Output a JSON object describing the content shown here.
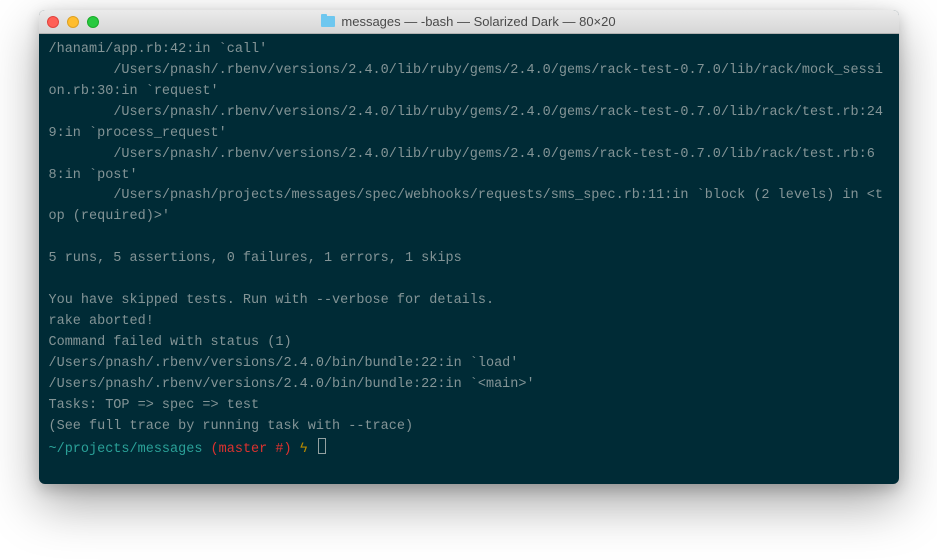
{
  "window": {
    "title": "messages — -bash — Solarized Dark — 80×20"
  },
  "terminal": {
    "lines": {
      "l0": "/hanami/app.rb:42:in `call'",
      "l1": "        /Users/pnash/.rbenv/versions/2.4.0/lib/ruby/gems/2.4.0/gems/rack-test-0.7.0/lib/rack/mock_session.rb:30:in `request'",
      "l2": "        /Users/pnash/.rbenv/versions/2.4.0/lib/ruby/gems/2.4.0/gems/rack-test-0.7.0/lib/rack/test.rb:249:in `process_request'",
      "l3": "        /Users/pnash/.rbenv/versions/2.4.0/lib/ruby/gems/2.4.0/gems/rack-test-0.7.0/lib/rack/test.rb:68:in `post'",
      "l4": "        /Users/pnash/projects/messages/spec/webhooks/requests/sms_spec.rb:11:in `block (2 levels) in <top (required)>'",
      "blank1": "",
      "results": "5 runs, 5 assertions, 0 failures, 1 errors, 1 skips",
      "blank2": "",
      "skipped": "You have skipped tests. Run with --verbose for details.",
      "aborted": "rake aborted!",
      "cmdfail": "Command failed with status (1)",
      "trace1": "/Users/pnash/.rbenv/versions/2.4.0/bin/bundle:22:in `load'",
      "trace2": "/Users/pnash/.rbenv/versions/2.4.0/bin/bundle:22:in `<main>'",
      "tasks": "Tasks: TOP => spec => test",
      "seefull": "(See full trace by running task with --trace)"
    },
    "prompt": {
      "path": "~/projects/messages",
      "branch": "(master #)",
      "bolt": "ϟ"
    }
  }
}
